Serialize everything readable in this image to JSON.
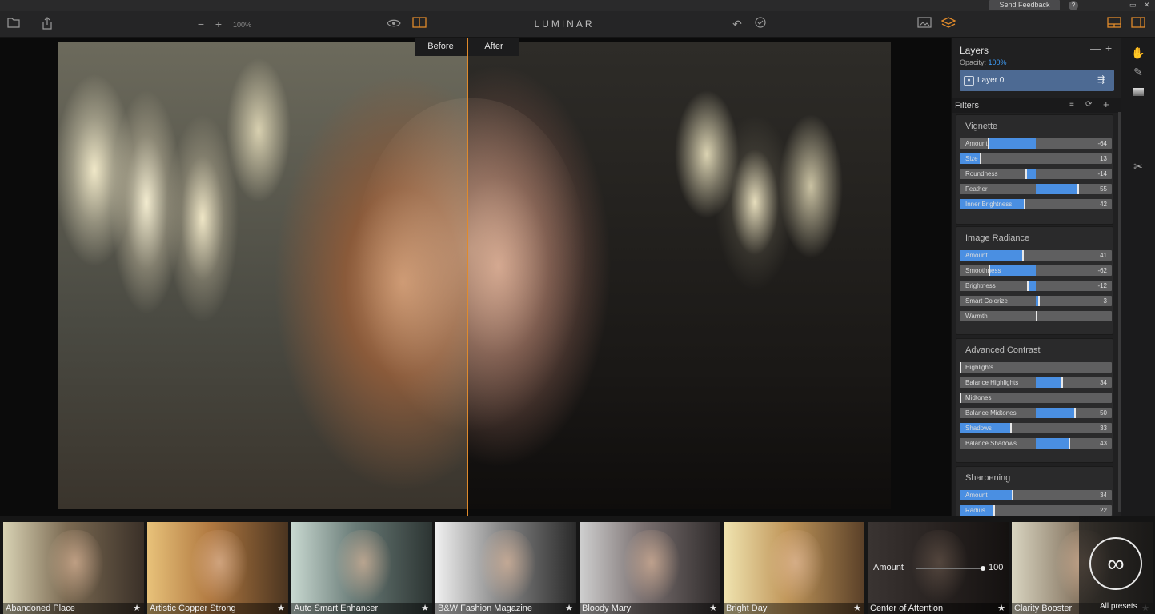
{
  "system": {
    "feedback_label": "Send Feedback",
    "help_label": "?",
    "win_controls": [
      "▭",
      "✕"
    ]
  },
  "toolbar": {
    "zoom_value": "100%",
    "app_title": "LUMINAR",
    "accent_color": "#e08a2b"
  },
  "compare": {
    "before_label": "Before",
    "after_label": "After"
  },
  "layers": {
    "title": "Layers",
    "opacity_label": "Opacity:",
    "opacity_value": "100%",
    "layer_name": "Layer 0"
  },
  "filters": {
    "title": "Filters",
    "groups": [
      {
        "title": "Vignette",
        "sliders": [
          {
            "label": "Amount",
            "value": "-64",
            "fill_from": 0.185,
            "fill_to": 0.5,
            "knob": 0.185
          },
          {
            "label": "Size",
            "value": "13",
            "fill_from": 0.0,
            "fill_to": 0.13,
            "knob": 0.13
          },
          {
            "label": "Roundness",
            "value": "-14",
            "fill_from": 0.43,
            "fill_to": 0.5,
            "knob": 0.43
          },
          {
            "label": "Feather",
            "value": "55",
            "fill_from": 0.5,
            "fill_to": 0.775,
            "knob": 0.775
          },
          {
            "label": "Inner Brightness",
            "value": "42",
            "fill_from": 0.0,
            "fill_to": 0.42,
            "knob": 0.42
          }
        ]
      },
      {
        "title": "Image Radiance",
        "sliders": [
          {
            "label": "Amount",
            "value": "41",
            "fill_from": 0.0,
            "fill_to": 0.41,
            "knob": 0.41
          },
          {
            "label": "Smoothness",
            "value": "-62",
            "fill_from": 0.19,
            "fill_to": 0.5,
            "knob": 0.19
          },
          {
            "label": "Brightness",
            "value": "-12",
            "fill_from": 0.44,
            "fill_to": 0.5,
            "knob": 0.44
          },
          {
            "label": "Smart Colorize",
            "value": "3",
            "fill_from": 0.5,
            "fill_to": 0.515,
            "knob": 0.515
          },
          {
            "label": "Warmth",
            "value": "",
            "fill_from": 0.5,
            "fill_to": 0.5,
            "knob": 0.5
          }
        ]
      },
      {
        "title": "Advanced Contrast",
        "sliders": [
          {
            "label": "Highlights",
            "value": "",
            "fill_from": 0.0,
            "fill_to": 0.0,
            "knob": 0.0
          },
          {
            "label": "Balance Highlights",
            "value": "34",
            "fill_from": 0.5,
            "fill_to": 0.67,
            "knob": 0.67
          },
          {
            "label": "Midtones",
            "value": "",
            "fill_from": 0.0,
            "fill_to": 0.0,
            "knob": 0.0
          },
          {
            "label": "Balance Midtones",
            "value": "50",
            "fill_from": 0.5,
            "fill_to": 0.75,
            "knob": 0.75
          },
          {
            "label": "Shadows",
            "value": "33",
            "fill_from": 0.0,
            "fill_to": 0.33,
            "knob": 0.33
          },
          {
            "label": "Balance Shadows",
            "value": "43",
            "fill_from": 0.5,
            "fill_to": 0.715,
            "knob": 0.715
          }
        ]
      },
      {
        "title": "Sharpening",
        "sliders": [
          {
            "label": "Amount",
            "value": "34",
            "fill_from": 0.0,
            "fill_to": 0.34,
            "knob": 0.34
          },
          {
            "label": "Radius",
            "value": "22",
            "fill_from": 0.0,
            "fill_to": 0.22,
            "knob": 0.22
          }
        ]
      }
    ]
  },
  "presets": {
    "items": [
      {
        "name": "Abandoned Place",
        "tone": "warm"
      },
      {
        "name": "Artistic Copper Strong",
        "tone": "copper"
      },
      {
        "name": "Auto Smart Enhancer",
        "tone": "cool"
      },
      {
        "name": "B&W Fashion Magazine",
        "tone": "bw"
      },
      {
        "name": "Bloody Mary",
        "tone": "muted"
      },
      {
        "name": "Bright Day",
        "tone": "bright"
      },
      {
        "name": "Center of Attention",
        "tone": "dark"
      },
      {
        "name": "Clarity Booster",
        "tone": "clear"
      }
    ],
    "active_amount_label": "Amount",
    "active_amount_value": "100",
    "all_presets_label": "All presets",
    "all_presets_icon": "∞"
  }
}
